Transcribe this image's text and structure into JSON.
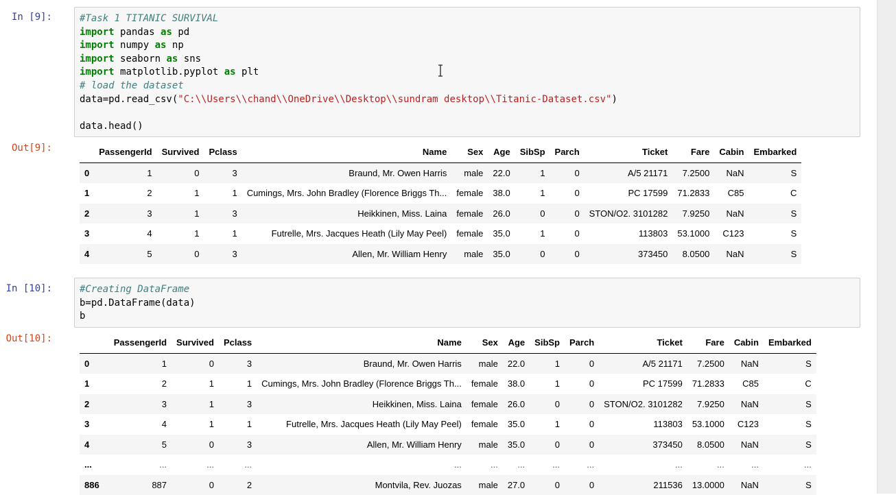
{
  "cell1": {
    "in_prompt": "In [9]:",
    "out_prompt": "Out[9]:",
    "code": {
      "comment1": "#Task 1 TITANIC SURVIVAL",
      "kw_import": "import",
      "kw_as": "as",
      "mod_pandas": "pandas",
      "alias_pd": "pd",
      "mod_numpy": "numpy",
      "alias_np": "np",
      "mod_seaborn": "seaborn",
      "alias_sns": "sns",
      "mod_matplotlib": "matplotlib.pyplot",
      "alias_plt": "plt",
      "comment2": "# load the dataset",
      "read_prefix": "data=pd.read_csv(",
      "read_path": "\"C:\\\\Users\\\\chand\\\\OneDrive\\\\Desktop\\\\sundram desktop\\\\Titanic-Dataset.csv\"",
      "read_suffix": ")",
      "head_call": "data.head()"
    }
  },
  "cell2": {
    "in_prompt": "In [10]:",
    "out_prompt": "Out[10]:",
    "code": {
      "comment1": "#Creating DataFrame",
      "line2": "b=pd.DataFrame(data)",
      "line3": "b"
    }
  },
  "table_headers": [
    "",
    "PassengerId",
    "Survived",
    "Pclass",
    "Name",
    "Sex",
    "Age",
    "SibSp",
    "Parch",
    "Ticket",
    "Fare",
    "Cabin",
    "Embarked"
  ],
  "rows": [
    {
      "idx": "0",
      "cells": [
        "1",
        "0",
        "3",
        "Braund, Mr. Owen Harris",
        "male",
        "22.0",
        "1",
        "0",
        "A/5 21171",
        "7.2500",
        "NaN",
        "S"
      ]
    },
    {
      "idx": "1",
      "cells": [
        "2",
        "1",
        "1",
        "Cumings, Mrs. John Bradley (Florence Briggs Th...",
        "female",
        "38.0",
        "1",
        "0",
        "PC 17599",
        "71.2833",
        "C85",
        "C"
      ]
    },
    {
      "idx": "2",
      "cells": [
        "3",
        "1",
        "3",
        "Heikkinen, Miss. Laina",
        "female",
        "26.0",
        "0",
        "0",
        "STON/O2. 3101282",
        "7.9250",
        "NaN",
        "S"
      ]
    },
    {
      "idx": "3",
      "cells": [
        "4",
        "1",
        "1",
        "Futrelle, Mrs. Jacques Heath (Lily May Peel)",
        "female",
        "35.0",
        "1",
        "0",
        "113803",
        "53.1000",
        "C123",
        "S"
      ]
    },
    {
      "idx": "4",
      "cells": [
        "5",
        "0",
        "3",
        "Allen, Mr. William Henry",
        "male",
        "35.0",
        "0",
        "0",
        "373450",
        "8.0500",
        "NaN",
        "S"
      ]
    }
  ],
  "ellipsis_row": {
    "idx": "...",
    "cells": [
      "...",
      "...",
      "...",
      "...",
      "...",
      "...",
      "...",
      "...",
      "...",
      "...",
      "...",
      "..."
    ]
  },
  "last_row": {
    "idx": "886",
    "cells": [
      "887",
      "0",
      "2",
      "Montvila, Rev. Juozas",
      "male",
      "27.0",
      "0",
      "0",
      "211536",
      "13.0000",
      "NaN",
      "S"
    ]
  },
  "colors": {
    "in_prompt": "#303f9f",
    "out_prompt": "#d84315",
    "keyword": "#008000",
    "comment": "#408080",
    "string": "#ba2121"
  },
  "icons": {
    "cursor": "text-cursor-icon"
  }
}
